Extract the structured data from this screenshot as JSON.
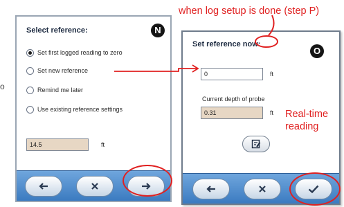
{
  "annotation_top": "when log setup is done (step P)",
  "edge_mark": "o",
  "screen_n": {
    "title": "Select reference:",
    "step_badge": "N",
    "options": [
      {
        "label": "Set first logged reading to zero",
        "checked": true
      },
      {
        "label": "Set new reference",
        "checked": false
      },
      {
        "label": "Remind me later",
        "checked": false
      },
      {
        "label": "Use existing reference settings",
        "checked": false
      }
    ],
    "reference_value": "14.5",
    "unit": "ft",
    "toolbar": {
      "back_icon": "arrow-left-icon",
      "cancel_icon": "close-icon",
      "next_icon": "arrow-right-icon"
    }
  },
  "screen_o": {
    "title": "Set reference now:",
    "step_badge": "O",
    "new_reference_value": "0",
    "unit_1": "ft",
    "probe_depth_label": "Current depth of probe",
    "probe_depth_value": "0.31",
    "unit_2": "ft",
    "edit_icon": "edit-icon",
    "toolbar": {
      "back_icon": "arrow-left-icon",
      "cancel_icon": "close-icon",
      "confirm_icon": "check-icon"
    }
  },
  "note_realtime": [
    "Real-time",
    "reading"
  ],
  "colors": {
    "annotation_red": "#e02020",
    "toolbar_blue": "#3b7bc0",
    "field_tan": "#e7d7c4"
  }
}
